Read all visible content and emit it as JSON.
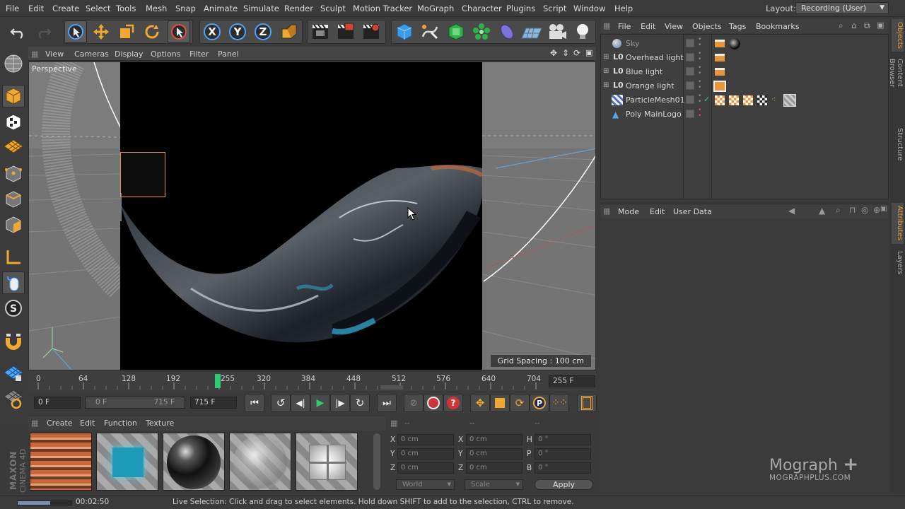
{
  "menu": {
    "items": [
      "File",
      "Edit",
      "Create",
      "Select",
      "Tools",
      "Mesh",
      "Snap",
      "Animate",
      "Simulate",
      "Render",
      "Sculpt",
      "Motion Tracker",
      "MoGraph",
      "Character",
      "Plugins",
      "Script",
      "Window",
      "Help"
    ],
    "layout_label": "Layout:",
    "layout_value": "Recording (User)"
  },
  "toolbar": {
    "icons": [
      "undo-icon",
      "redo-icon",
      "live-selection-icon",
      "move-icon",
      "scale-icon",
      "rotate-icon",
      "recent-tool-icon",
      "x-axis-icon",
      "y-axis-icon",
      "z-axis-icon",
      "coordinate-system-icon",
      "render-view-icon",
      "render-picture-viewer-icon",
      "render-settings-icon",
      "cube-icon",
      "pen-icon",
      "subdivision-icon",
      "cloner-icon",
      "deformer-icon",
      "floor-icon",
      "camera-icon",
      "light-icon"
    ],
    "axis_labels": [
      "X",
      "Y",
      "Z"
    ]
  },
  "viewport": {
    "menu": [
      "View",
      "Cameras",
      "Display",
      "Options",
      "Filter",
      "Panel"
    ],
    "label": "Perspective",
    "grid_spacing": "Grid Spacing : 100 cm",
    "accent_color": "#e8963c"
  },
  "timeline": {
    "ticks": [
      "0",
      "64",
      "128",
      "192",
      "255",
      "320",
      "384",
      "448",
      "512",
      "576",
      "640",
      "704"
    ],
    "current_frame": "255",
    "current_frame_field": "255 F",
    "current_color": "#2ecc71"
  },
  "transport": {
    "start_field": "0 F",
    "range_min": "0 F",
    "range_max": "715 F",
    "end_field": "715 F"
  },
  "material_manager": {
    "menu": [
      "Create",
      "Edit",
      "Function",
      "Texture"
    ]
  },
  "coordinates": {
    "header": [
      "--",
      "--",
      "--"
    ],
    "rows": [
      {
        "a": "X",
        "av": "0 cm",
        "b": "X",
        "bv": "0 cm",
        "c": "H",
        "cv": "0 °"
      },
      {
        "a": "Y",
        "av": "0 cm",
        "b": "Y",
        "bv": "0 cm",
        "c": "P",
        "cv": "0 °"
      },
      {
        "a": "Z",
        "av": "0 cm",
        "b": "Z",
        "bv": "0 cm",
        "c": "B",
        "cv": "0 °"
      }
    ],
    "world": "World",
    "scale": "Scale",
    "apply": "Apply"
  },
  "objects": {
    "menu": [
      "File",
      "Edit",
      "View",
      "Objects",
      "Tags",
      "Bookmarks"
    ],
    "items": [
      {
        "name": "Sky"
      },
      {
        "name": "Overhead light"
      },
      {
        "name": "Blue light"
      },
      {
        "name": "Orange light"
      },
      {
        "name": "ParticleMesh01"
      },
      {
        "name": "Poly MainLogo"
      }
    ]
  },
  "attributes": {
    "menu": [
      "Mode",
      "Edit",
      "User Data"
    ]
  },
  "side_tabs": [
    "Objects",
    "Content Browser",
    "Structure",
    "Attributes",
    "Layers"
  ],
  "branding": {
    "maxon": "MAXON",
    "cinema": "CINEMA 4D",
    "watermark": "Mograph",
    "watermark_plus": "+",
    "watermark_url": "MOGRAPHPLUS.COM"
  },
  "status": {
    "time": "00:02:50",
    "progress": 0.6,
    "message": "Live Selection: Click and drag to select elements. Hold down SHIFT to add to the selection, CTRL to remove."
  }
}
